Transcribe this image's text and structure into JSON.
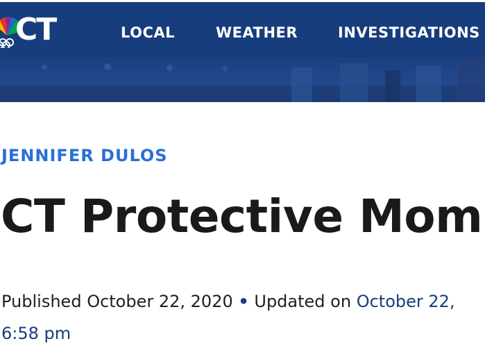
{
  "header": {
    "logo_text": "CT",
    "nav": [
      "LOCAL",
      "WEATHER",
      "INVESTIGATIONS"
    ]
  },
  "article": {
    "category": "JENNIFER DULOS",
    "headline": "CT Protective Mom",
    "published_label": "Published",
    "published_date": "October 22, 2020",
    "separator": "•",
    "updated_label": "Updated on",
    "updated_date": "October 22,",
    "updated_time": "6:58 pm"
  },
  "colors": {
    "nav_bg": "#173d7c",
    "category": "#2a6fd6",
    "headline": "#1a1a1a",
    "link": "#173d7c"
  },
  "icons": [
    "nbc-peacock-icon"
  ]
}
